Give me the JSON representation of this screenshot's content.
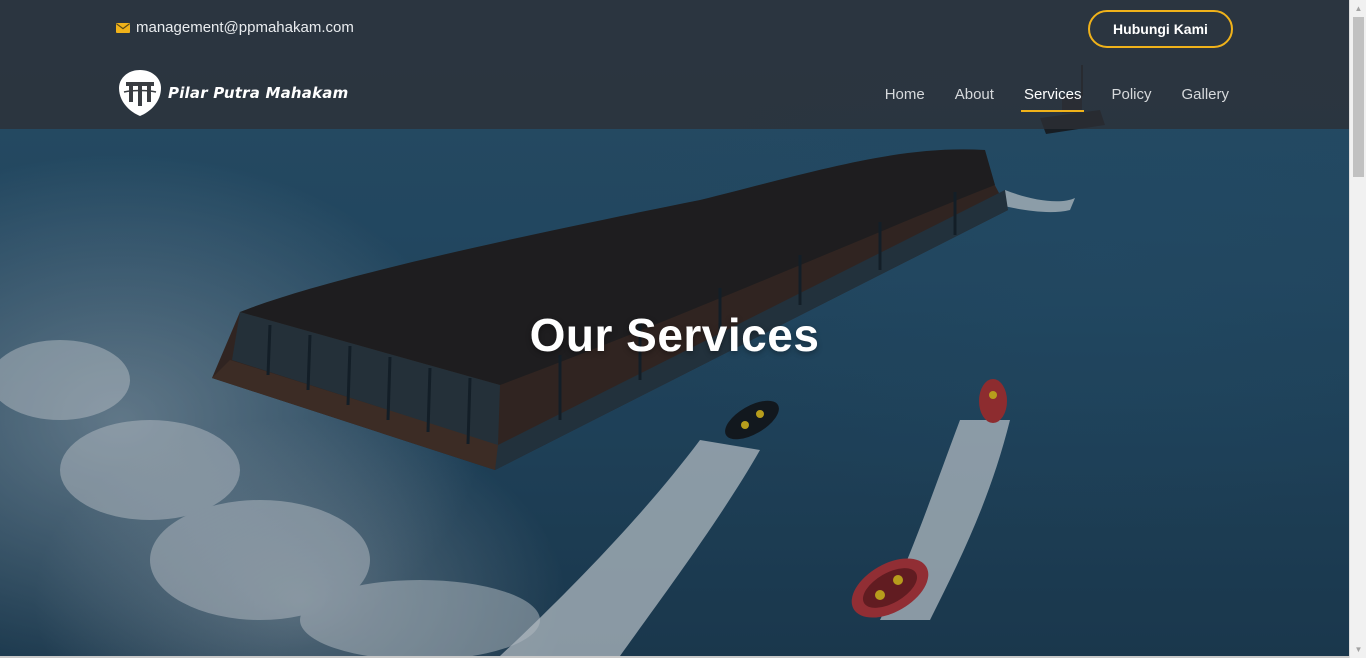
{
  "topbar": {
    "email": "management@ppmahakam.com",
    "cta_label": "Hubungi Kami"
  },
  "brand": {
    "name": "Pilar Putra Mahakam"
  },
  "nav": {
    "items": [
      {
        "label": "Home"
      },
      {
        "label": "About"
      },
      {
        "label": "Services",
        "active": true
      },
      {
        "label": "Policy"
      },
      {
        "label": "Gallery"
      }
    ]
  },
  "hero": {
    "title": "Our Services"
  },
  "colors": {
    "accent": "#f0b21a",
    "header_bg": "#2d3036",
    "text_light": "#ffffff"
  },
  "icons": {
    "email": "envelope-icon",
    "logo": "pillar-shield-logo"
  }
}
